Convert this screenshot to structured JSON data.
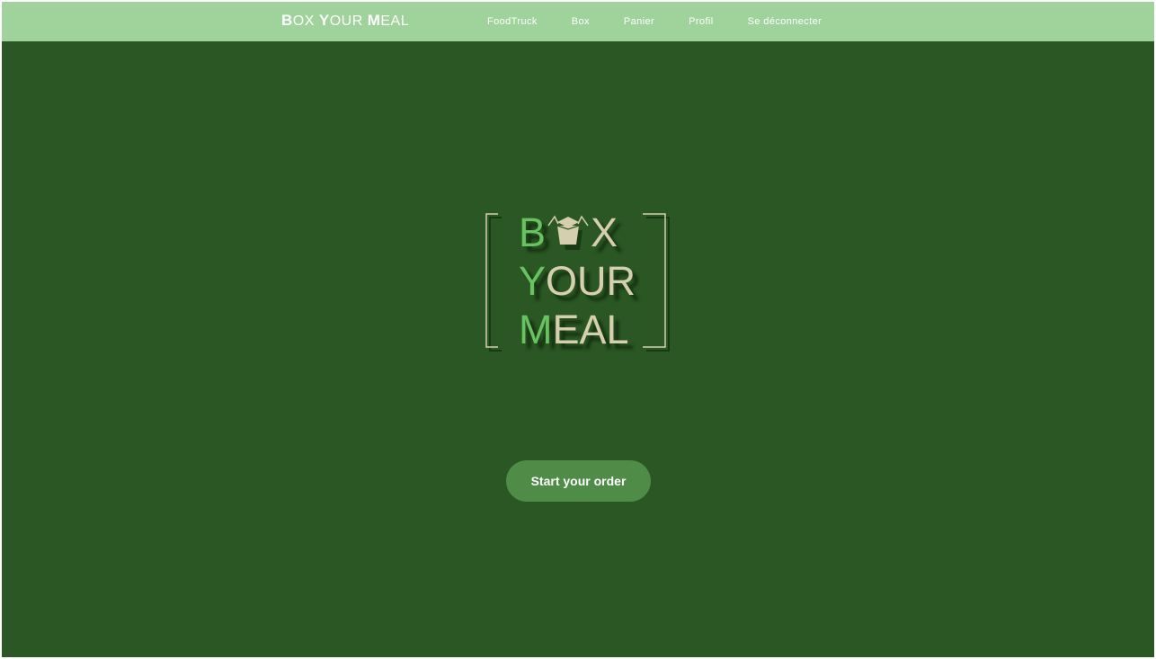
{
  "navbar": {
    "brand": {
      "b_cap": "B",
      "b_rest": "OX ",
      "y_cap": "Y",
      "y_rest": "OUR ",
      "m_cap": "M",
      "m_rest": "EAL"
    },
    "links": [
      {
        "label": "FoodTruck"
      },
      {
        "label": "Box"
      },
      {
        "label": "Panier"
      },
      {
        "label": "Profil"
      },
      {
        "label": "Se déconnecter"
      }
    ]
  },
  "hero": {
    "logo": {
      "line1_b": "B",
      "line1_x": "X",
      "line2_y": "Y",
      "line2_rest": "OUR",
      "line3_m": "M",
      "line3_rest": "EAL"
    },
    "cta_label": "Start your order"
  },
  "colors": {
    "navbar_bg": "#a0d39b",
    "page_bg": "#2a5723",
    "logo_accent": "#69c262",
    "logo_text": "#d6cfae",
    "button_bg": "#4e8c47"
  },
  "icons": {
    "logo_box": "takeout-box-icon"
  }
}
